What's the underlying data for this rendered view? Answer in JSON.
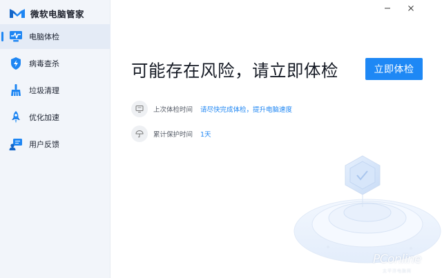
{
  "app": {
    "title": "微软电脑管家"
  },
  "window_controls": {
    "minimize": "–",
    "close": "×"
  },
  "sidebar": {
    "items": [
      {
        "label": "电脑体检",
        "icon": "monitor-pulse-icon",
        "active": true
      },
      {
        "label": "病毒查杀",
        "icon": "shield-icon",
        "active": false
      },
      {
        "label": "垃圾清理",
        "icon": "broom-icon",
        "active": false
      },
      {
        "label": "优化加速",
        "icon": "rocket-icon",
        "active": false
      },
      {
        "label": "用户反馈",
        "icon": "feedback-icon",
        "active": false
      }
    ]
  },
  "main": {
    "headline": "可能存在风险，请立即体检",
    "cta_label": "立即体检",
    "info": [
      {
        "label": "上次体检时间",
        "value": "请尽快完成体检，提升电脑速度",
        "icon": "monitor-icon"
      },
      {
        "label": "累计保护时间",
        "value": "1天",
        "icon": "umbrella-icon"
      }
    ]
  },
  "watermark": {
    "text": "PConline",
    "sub": "太平洋电脑网"
  },
  "colors": {
    "accent": "#1e88f5",
    "sidebar_bg": "#f2f5fa",
    "active_bg": "#e4ebf6",
    "link": "#1e86f3"
  }
}
